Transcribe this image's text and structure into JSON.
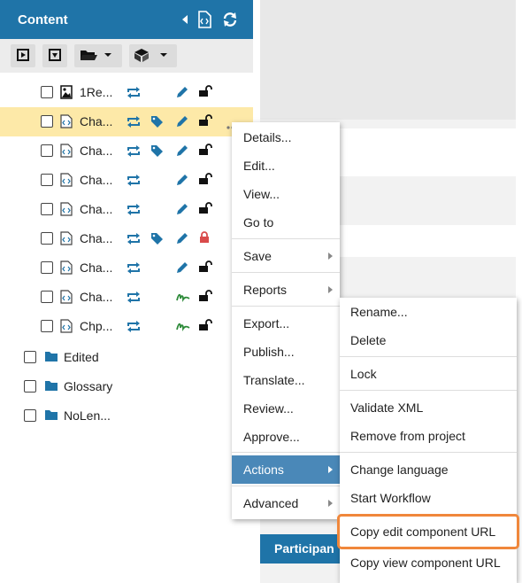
{
  "panel": {
    "title": "Content",
    "header_color": "#1f74a8"
  },
  "toolbar": {
    "buttons": [
      "expand-icon",
      "collapse-icon",
      "folder-menu-icon",
      "package-menu-icon"
    ]
  },
  "tree": {
    "rows": [
      {
        "label": "1Re...",
        "type": "image",
        "status": "unlocked",
        "tagged": false,
        "edit": "pencil"
      },
      {
        "label": "Cha...",
        "type": "xml",
        "status": "unlocked",
        "tagged": true,
        "edit": "pencil",
        "selected": true
      },
      {
        "label": "Cha...",
        "type": "xml",
        "status": "unlocked",
        "tagged": true,
        "edit": "pencil"
      },
      {
        "label": "Cha...",
        "type": "xml",
        "status": "unlocked",
        "tagged": false,
        "edit": "pencil"
      },
      {
        "label": "Cha...",
        "type": "xml",
        "status": "unlocked",
        "tagged": false,
        "edit": "pencil"
      },
      {
        "label": "Cha...",
        "type": "xml",
        "status": "locked",
        "tagged": true,
        "edit": "pencil"
      },
      {
        "label": "Cha...",
        "type": "xml",
        "status": "unlocked",
        "tagged": false,
        "edit": "pencil"
      },
      {
        "label": "Cha...",
        "type": "xml",
        "status": "unlocked",
        "tagged": false,
        "edit": "signature"
      },
      {
        "label": "Chp...",
        "type": "xml",
        "status": "unlocked",
        "tagged": false,
        "edit": "signature"
      }
    ],
    "folders": [
      "Edited",
      "Glossary",
      "NoLen..."
    ]
  },
  "context_menu": {
    "items": [
      "Details...",
      "Edit...",
      "View...",
      "Go to",
      "Save",
      "Reports",
      "Export...",
      "Publish...",
      "Translate...",
      "Review...",
      "Approve...",
      "Actions",
      "Advanced"
    ],
    "active": "Actions"
  },
  "actions_submenu": {
    "items": [
      "Rename...",
      "Delete",
      "Lock",
      "Validate XML",
      "Remove from project",
      "Change language",
      "Start Workflow",
      "Copy edit component URL",
      "Copy view component URL"
    ],
    "highlighted": "Copy edit component URL",
    "highlight_color": "#f0873b"
  },
  "participants_label": "Participan"
}
